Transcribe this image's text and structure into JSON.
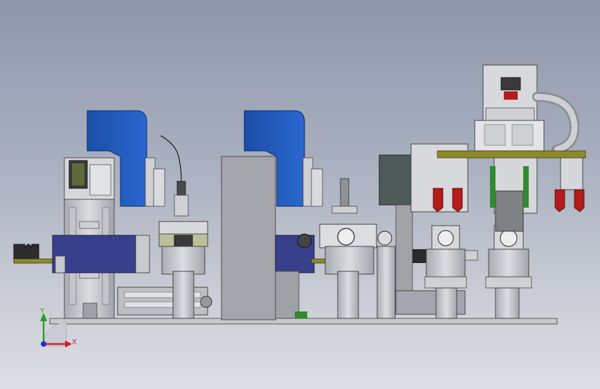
{
  "viewport": {
    "background_top": "#8f97ac",
    "background_bottom": "#dedfe4"
  },
  "colors": {
    "blue_guard": "#1f56b8",
    "navy_block": "#38408c",
    "steel": "#b9bcc2",
    "steel_light": "#dcdde0",
    "steel_dark": "#8e9196",
    "dark_panel": "#4d5a58",
    "olive_bar": "#8e8a2a",
    "red_gripper": "#b51b1b",
    "green_accent": "#2e8b2e",
    "base_plate": "#c8c9cc"
  },
  "triad": {
    "x_label": "X",
    "y_label": "Y",
    "x_color": "#d42020",
    "y_color": "#20a020",
    "z_color": "#2030c8"
  }
}
